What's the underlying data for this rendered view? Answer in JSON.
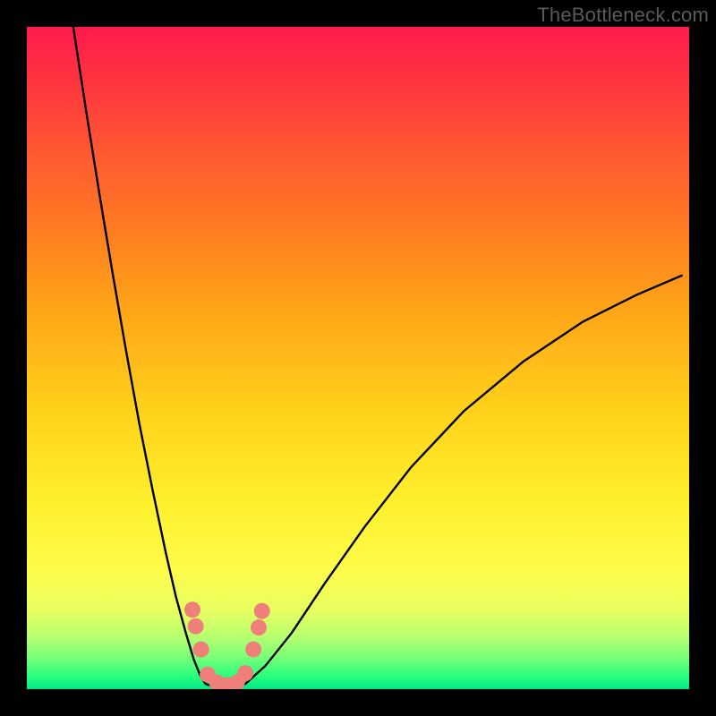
{
  "attribution": "TheBottleneck.com",
  "colors": {
    "frame": "#000000",
    "gradient_top": "#ff1a4d",
    "gradient_bottom": "#00e884",
    "curve": "#000000",
    "marker": "#ef8079"
  },
  "chart_data": {
    "type": "line",
    "title": "",
    "xlabel": "",
    "ylabel": "",
    "xlim": [
      0,
      1
    ],
    "ylim": [
      0,
      1
    ],
    "axes_visible": false,
    "notes": "V-shaped bottleneck curve over vertical red→green gradient. Left branch rises steeply to top-left; right branch rises with decreasing slope to mid-right. Salmon markers cluster near the trough.",
    "series": [
      {
        "name": "left-branch",
        "x": [
          0.07,
          0.09,
          0.11,
          0.13,
          0.15,
          0.17,
          0.19,
          0.21,
          0.225,
          0.24,
          0.252,
          0.262,
          0.27
        ],
        "y": [
          1.0,
          0.87,
          0.745,
          0.625,
          0.51,
          0.4,
          0.3,
          0.205,
          0.14,
          0.085,
          0.045,
          0.02,
          0.008
        ]
      },
      {
        "name": "trough",
        "x": [
          0.27,
          0.285,
          0.3,
          0.315,
          0.33
        ],
        "y": [
          0.008,
          0.003,
          0.002,
          0.003,
          0.008
        ]
      },
      {
        "name": "right-branch",
        "x": [
          0.33,
          0.36,
          0.4,
          0.45,
          0.51,
          0.58,
          0.66,
          0.75,
          0.84,
          0.92,
          0.99
        ],
        "y": [
          0.008,
          0.035,
          0.085,
          0.16,
          0.245,
          0.335,
          0.42,
          0.495,
          0.555,
          0.595,
          0.625
        ]
      }
    ],
    "markers": [
      {
        "x": 0.25,
        "y": 0.12,
        "r": 9
      },
      {
        "x": 0.255,
        "y": 0.095,
        "r": 9
      },
      {
        "x": 0.263,
        "y": 0.06,
        "r": 9
      },
      {
        "x": 0.273,
        "y": 0.022,
        "r": 9
      },
      {
        "x": 0.287,
        "y": 0.01,
        "r": 9
      },
      {
        "x": 0.302,
        "y": 0.006,
        "r": 9
      },
      {
        "x": 0.317,
        "y": 0.01,
        "r": 9
      },
      {
        "x": 0.33,
        "y": 0.024,
        "r": 9
      },
      {
        "x": 0.342,
        "y": 0.06,
        "r": 9
      },
      {
        "x": 0.35,
        "y": 0.093,
        "r": 9
      },
      {
        "x": 0.355,
        "y": 0.118,
        "r": 9
      }
    ]
  }
}
